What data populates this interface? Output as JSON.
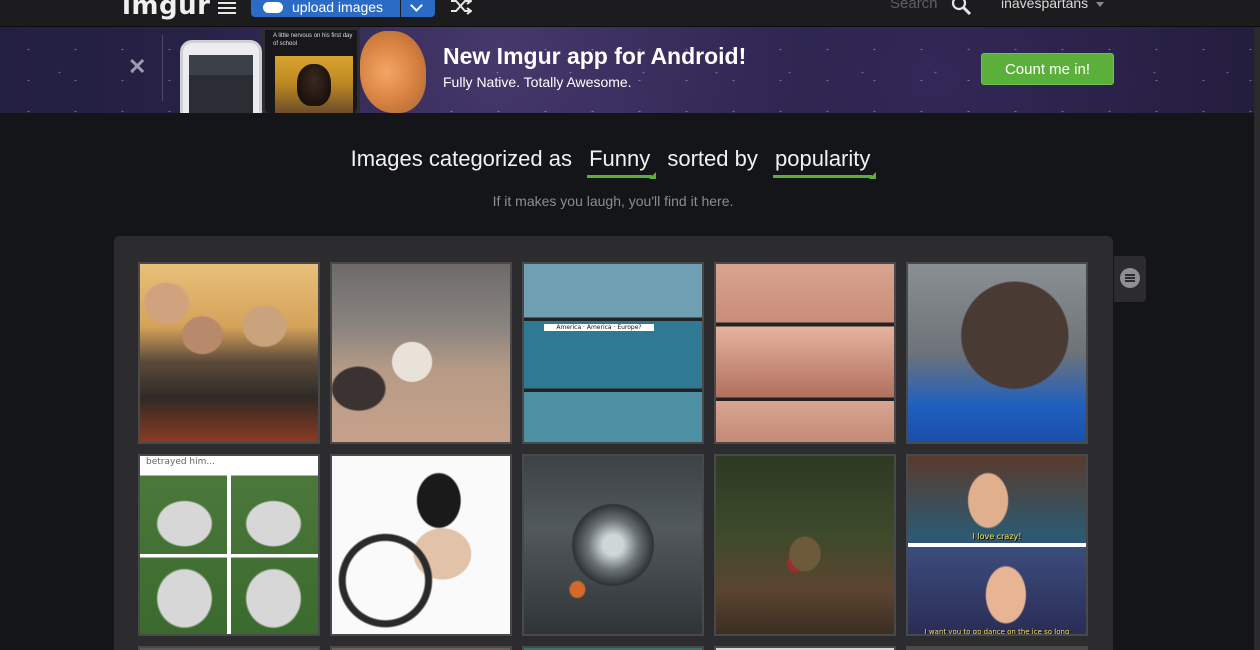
{
  "nav": {
    "logo": "imgur",
    "upload_label": "upload images",
    "search_placeholder": "Search",
    "username": "inavespartans",
    "icons": [
      "menu-icon",
      "cloud-upload-icon",
      "chevron-down-icon",
      "shuffle-icon",
      "search-icon",
      "caret-down-icon"
    ]
  },
  "banner": {
    "title": "New Imgur app for Android!",
    "subtitle": "Fully Native. Totally Awesome.",
    "cta": "Count me in!",
    "close_glyph": "✕",
    "phone_caption": "A little nervous on his first day of school",
    "accent_color": "#5ab03a"
  },
  "heading": {
    "prefix": "Images categorized as",
    "category": "Funny",
    "middle": "sorted by",
    "sort": "popularity",
    "subtitle": "If it makes you laugh, you'll find it here."
  },
  "gallery": {
    "thumbnails": [
      {
        "name": "thumb-poker-friends",
        "caption": ""
      },
      {
        "name": "thumb-old-man-cane",
        "caption": ""
      },
      {
        "name": "thumb-alien-comic",
        "caption": "America · America · Europe?"
      },
      {
        "name": "thumb-comic-woman",
        "caption": ""
      },
      {
        "name": "thumb-selfie-glasses",
        "caption": ""
      },
      {
        "name": "thumb-husky-grid",
        "caption": "betrayed him..."
      },
      {
        "name": "thumb-wheelchair",
        "caption": ""
      },
      {
        "name": "thumb-ufo-water",
        "caption": ""
      },
      {
        "name": "thumb-forest-man",
        "caption": ""
      },
      {
        "name": "thumb-frozen-prince",
        "caption": "I love crazy!"
      }
    ],
    "bottom_caption": "I want you to go dance on the ice so long"
  }
}
